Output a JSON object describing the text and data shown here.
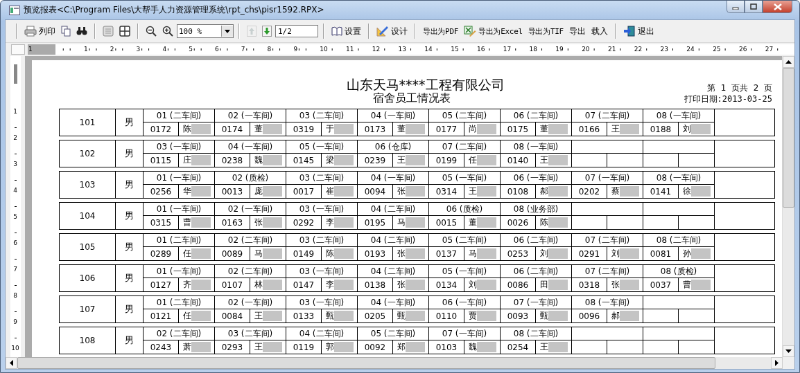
{
  "window": {
    "title": "预览报表<C:\\Program Files\\大帮手人力资源管理系统\\rpt_chs\\pisr1592.RPX>"
  },
  "toolbar": {
    "print_label": "列印",
    "zoom_value": "100 %",
    "prev_page_disabled": true,
    "page_field": "1/2",
    "setup_label": "设置",
    "design_label": "设计",
    "export_pdf_label": "导出为PDF",
    "export_excel_label": "导出为Excel",
    "export_tif_label": "导出为TIF",
    "export_label": "导出",
    "load_label": "载入",
    "exit_label": "退出"
  },
  "h_ruler": [
    "1",
    "1",
    "2",
    "3",
    "4",
    "5",
    "6",
    "7",
    "8",
    "9",
    "10",
    "11",
    "12",
    "13",
    "14",
    "15",
    "16",
    "17",
    "18",
    "19",
    "20",
    "21",
    "22",
    "23",
    "24",
    "25",
    "26",
    "27"
  ],
  "v_ruler": [
    "1",
    "2",
    "3",
    "4",
    "5",
    "6",
    "7",
    "8",
    "9",
    "10"
  ],
  "report": {
    "company": "山东天马****工程有限公司",
    "title": "宿舍员工情况表",
    "page_info": "第  1  页共  2  页",
    "print_date": "打印日期:2013-03-25",
    "rooms": [
      {
        "room": "101",
        "gender": "男",
        "slots": [
          {
            "kind": "resident",
            "header": "01 (二车间)",
            "id": "0172",
            "name": "陈",
            "redacted": true
          },
          {
            "kind": "resident",
            "header": "02 (一车间)",
            "id": "0174",
            "name": "董",
            "redacted": true
          },
          {
            "kind": "resident",
            "header": "03 (二车间)",
            "id": "0319",
            "name": "于",
            "redacted": true
          },
          {
            "kind": "resident",
            "header": "04 (一车间)",
            "id": "0173",
            "name": "董",
            "redacted": true
          },
          {
            "kind": "resident",
            "header": "05 (二车间)",
            "id": "0177",
            "name": "尚",
            "redacted": true
          },
          {
            "kind": "resident",
            "header": "06 (二车间)",
            "id": "0175",
            "name": "董",
            "redacted": true
          },
          {
            "kind": "resident",
            "header": "07 (二车间)",
            "id": "0166",
            "name": "王",
            "redacted": true
          },
          {
            "kind": "resident",
            "header": "08 (一车间)",
            "id": "0188",
            "name": "刘",
            "redacted": true
          }
        ]
      },
      {
        "room": "102",
        "gender": "男",
        "slots": [
          {
            "kind": "resident",
            "header": "03 (一车间)",
            "id": "0115",
            "name": "庄",
            "redacted": true
          },
          {
            "kind": "resident",
            "header": "04 (一车间)",
            "id": "0238",
            "name": "魏",
            "redacted": true
          },
          {
            "kind": "resident",
            "header": "05 (一车间)",
            "id": "0145",
            "name": "梁",
            "redacted": true
          },
          {
            "kind": "resident",
            "header": "06 (仓库)",
            "id": "0239",
            "name": "王",
            "redacted": true
          },
          {
            "kind": "resident",
            "header": "07 (二车间)",
            "id": "0199",
            "name": "任",
            "redacted": true
          },
          {
            "kind": "resident",
            "header": "08 (一车间)",
            "id": "0140",
            "name": "王",
            "redacted": true
          },
          {
            "kind": "empty"
          },
          {
            "kind": "empty"
          }
        ]
      },
      {
        "room": "103",
        "gender": "男",
        "slots": [
          {
            "kind": "resident",
            "header": "01 (一车间)",
            "id": "0256",
            "name": "华",
            "redacted": true
          },
          {
            "kind": "resident",
            "header": "02 (质检)",
            "id": "0013",
            "name": "庞",
            "redacted": true
          },
          {
            "kind": "resident",
            "header": "03 (二车间)",
            "id": "0017",
            "name": "崔",
            "redacted": true
          },
          {
            "kind": "resident",
            "header": "04 (一车间)",
            "id": "0094",
            "name": "张",
            "redacted": true
          },
          {
            "kind": "resident",
            "header": "05 (一车间)",
            "id": "0314",
            "name": "王",
            "redacted": true
          },
          {
            "kind": "resident",
            "header": "06 (一车间)",
            "id": "0108",
            "name": "郝",
            "redacted": true
          },
          {
            "kind": "resident",
            "header": "07 (一车间)",
            "id": "0202",
            "name": "蔡",
            "redacted": true
          },
          {
            "kind": "resident",
            "header": "08 (一车间)",
            "id": "0141",
            "name": "徐",
            "redacted": true
          }
        ]
      },
      {
        "room": "104",
        "gender": "男",
        "slots": [
          {
            "kind": "resident",
            "header": "01 (一车间)",
            "id": "0315",
            "name": "曹",
            "redacted": true
          },
          {
            "kind": "resident",
            "header": "02 (一车间)",
            "id": "0163",
            "name": "张",
            "redacted": true
          },
          {
            "kind": "resident",
            "header": "03 (一车间)",
            "id": "0292",
            "name": "李",
            "redacted": true
          },
          {
            "kind": "resident",
            "header": "04 (二车间)",
            "id": "0195",
            "name": "马",
            "redacted": true
          },
          {
            "kind": "resident",
            "header": "06 (质检)",
            "id": "0015",
            "name": "董",
            "redacted": true
          },
          {
            "kind": "resident",
            "header": "08 (业务部)",
            "id": "0026",
            "name": "陈",
            "redacted": true
          },
          {
            "kind": "empty"
          },
          {
            "kind": "empty"
          }
        ]
      },
      {
        "room": "105",
        "gender": "男",
        "slots": [
          {
            "kind": "resident",
            "header": "01 (二车间)",
            "id": "0289",
            "name": "任",
            "redacted": true
          },
          {
            "kind": "resident",
            "header": "02 (二车间)",
            "id": "0089",
            "name": "马",
            "redacted": true
          },
          {
            "kind": "resident",
            "header": "03 (二车间)",
            "id": "0149",
            "name": "陈",
            "redacted": true
          },
          {
            "kind": "resident",
            "header": "04 (二车间)",
            "id": "0193",
            "name": "张",
            "redacted": true
          },
          {
            "kind": "resident",
            "header": "05 (二车间)",
            "id": "0137",
            "name": "马",
            "redacted": true
          },
          {
            "kind": "resident",
            "header": "06 (二车间)",
            "id": "0253",
            "name": "刘",
            "redacted": true
          },
          {
            "kind": "resident",
            "header": "07 (二车间)",
            "id": "0291",
            "name": "刘",
            "redacted": true
          },
          {
            "kind": "resident",
            "header": "08 (二车间)",
            "id": "0081",
            "name": "孙",
            "redacted": true
          }
        ]
      },
      {
        "room": "106",
        "gender": "男",
        "slots": [
          {
            "kind": "resident",
            "header": "01 (一车间)",
            "id": "0127",
            "name": "齐",
            "redacted": true
          },
          {
            "kind": "resident",
            "header": "02 (二车间)",
            "id": "0107",
            "name": "林",
            "redacted": true
          },
          {
            "kind": "resident",
            "header": "03 (一车间)",
            "id": "0147",
            "name": "李",
            "redacted": true
          },
          {
            "kind": "resident",
            "header": "04 (二车间)",
            "id": "0138",
            "name": "张",
            "redacted": true
          },
          {
            "kind": "resident",
            "header": "05 (一车间)",
            "id": "0134",
            "name": "刘",
            "redacted": true
          },
          {
            "kind": "resident",
            "header": "06 (二车间)",
            "id": "0086",
            "name": "田",
            "redacted": true
          },
          {
            "kind": "resident",
            "header": "07 (二车间)",
            "id": "0318",
            "name": "张",
            "redacted": true
          },
          {
            "kind": "resident",
            "header": "08 (质检)",
            "id": "0037",
            "name": "曹",
            "redacted": true
          }
        ]
      },
      {
        "room": "107",
        "gender": "男",
        "slots": [
          {
            "kind": "resident",
            "header": "01 (二车间)",
            "id": "0121",
            "name": "任",
            "redacted": true
          },
          {
            "kind": "resident",
            "header": "02 (一车间)",
            "id": "0084",
            "name": "王",
            "redacted": true
          },
          {
            "kind": "resident",
            "header": "03 (一车间)",
            "id": "0133",
            "name": "甄",
            "redacted": true
          },
          {
            "kind": "resident",
            "header": "04 (一车间)",
            "id": "0205",
            "name": "甄",
            "redacted": true
          },
          {
            "kind": "resident",
            "header": "06 (一车间)",
            "id": "0110",
            "name": "贾",
            "redacted": true
          },
          {
            "kind": "resident",
            "header": "07 (一车间)",
            "id": "0093",
            "name": "甄",
            "redacted": true
          },
          {
            "kind": "resident",
            "header": "08 (一车间)",
            "id": "0096",
            "name": "郝",
            "redacted": true
          },
          {
            "kind": "empty"
          }
        ]
      },
      {
        "room": "108",
        "gender": "男",
        "slots": [
          {
            "kind": "resident",
            "header": "02 (二车间)",
            "id": "0243",
            "name": "萧",
            "redacted": true
          },
          {
            "kind": "resident",
            "header": "03 (二车间)",
            "id": "0293",
            "name": "王",
            "redacted": true
          },
          {
            "kind": "resident",
            "header": "04 (二车间)",
            "id": "0119",
            "name": "郭",
            "redacted": true
          },
          {
            "kind": "resident",
            "header": "05 (二车间)",
            "id": "0092",
            "name": "郑",
            "redacted": true
          },
          {
            "kind": "resident",
            "header": "07 (一车间)",
            "id": "0103",
            "name": "魏",
            "redacted": true
          },
          {
            "kind": "resident",
            "header": "08 (二车间)",
            "id": "0254",
            "name": "王",
            "redacted": true
          },
          {
            "kind": "empty"
          },
          {
            "kind": "empty"
          }
        ]
      }
    ]
  }
}
